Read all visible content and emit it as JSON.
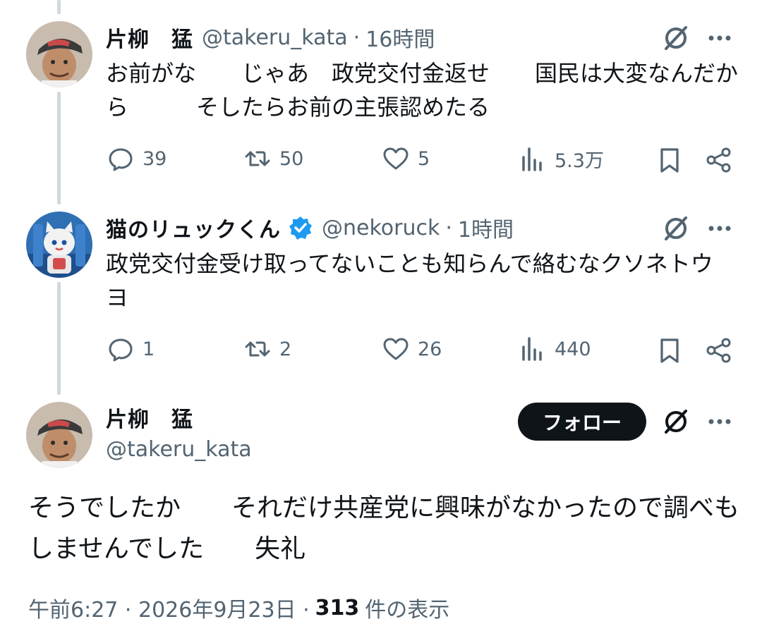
{
  "reply1": {
    "name": "片柳　猛",
    "handle": "@takeru_kata",
    "separator": "·",
    "time": "16時間",
    "text": "お前がな　　じゃあ　政党交付金返せ　　国民は大変なんだから　　　そしたらお前の主張認めたる",
    "replies": "39",
    "reposts": "50",
    "likes": "5",
    "views": "5.3万"
  },
  "reply2": {
    "name": "猫のリュックくん",
    "handle": "@nekoruck",
    "separator": "·",
    "time": "1時間",
    "text": "政党交付金受け取ってないことも知らんで絡むなクソネトウヨ",
    "replies": "1",
    "reposts": "2",
    "likes": "26",
    "views": "440"
  },
  "main": {
    "name": "片柳　猛",
    "handle": "@takeru_kata",
    "follow_label": "フォロー",
    "text": "そうでしたか　　それだけ共産党に興味がなかったので調べもしませんでした　　失礼",
    "timestamp": "午前6:27 · 2026年9月23日 ·",
    "views_count": "313",
    "views_label": "件の表示"
  },
  "colors": {
    "text": "#0f1419",
    "secondary": "#536471",
    "verified": "#1d9bf0",
    "thread_line": "#cfd9de",
    "follow_bg": "#0f1419"
  },
  "icons": [
    "grok-icon",
    "more-icon",
    "reply-icon",
    "repost-icon",
    "like-icon",
    "views-icon",
    "bookmark-icon",
    "share-icon",
    "verified-badge-icon"
  ]
}
